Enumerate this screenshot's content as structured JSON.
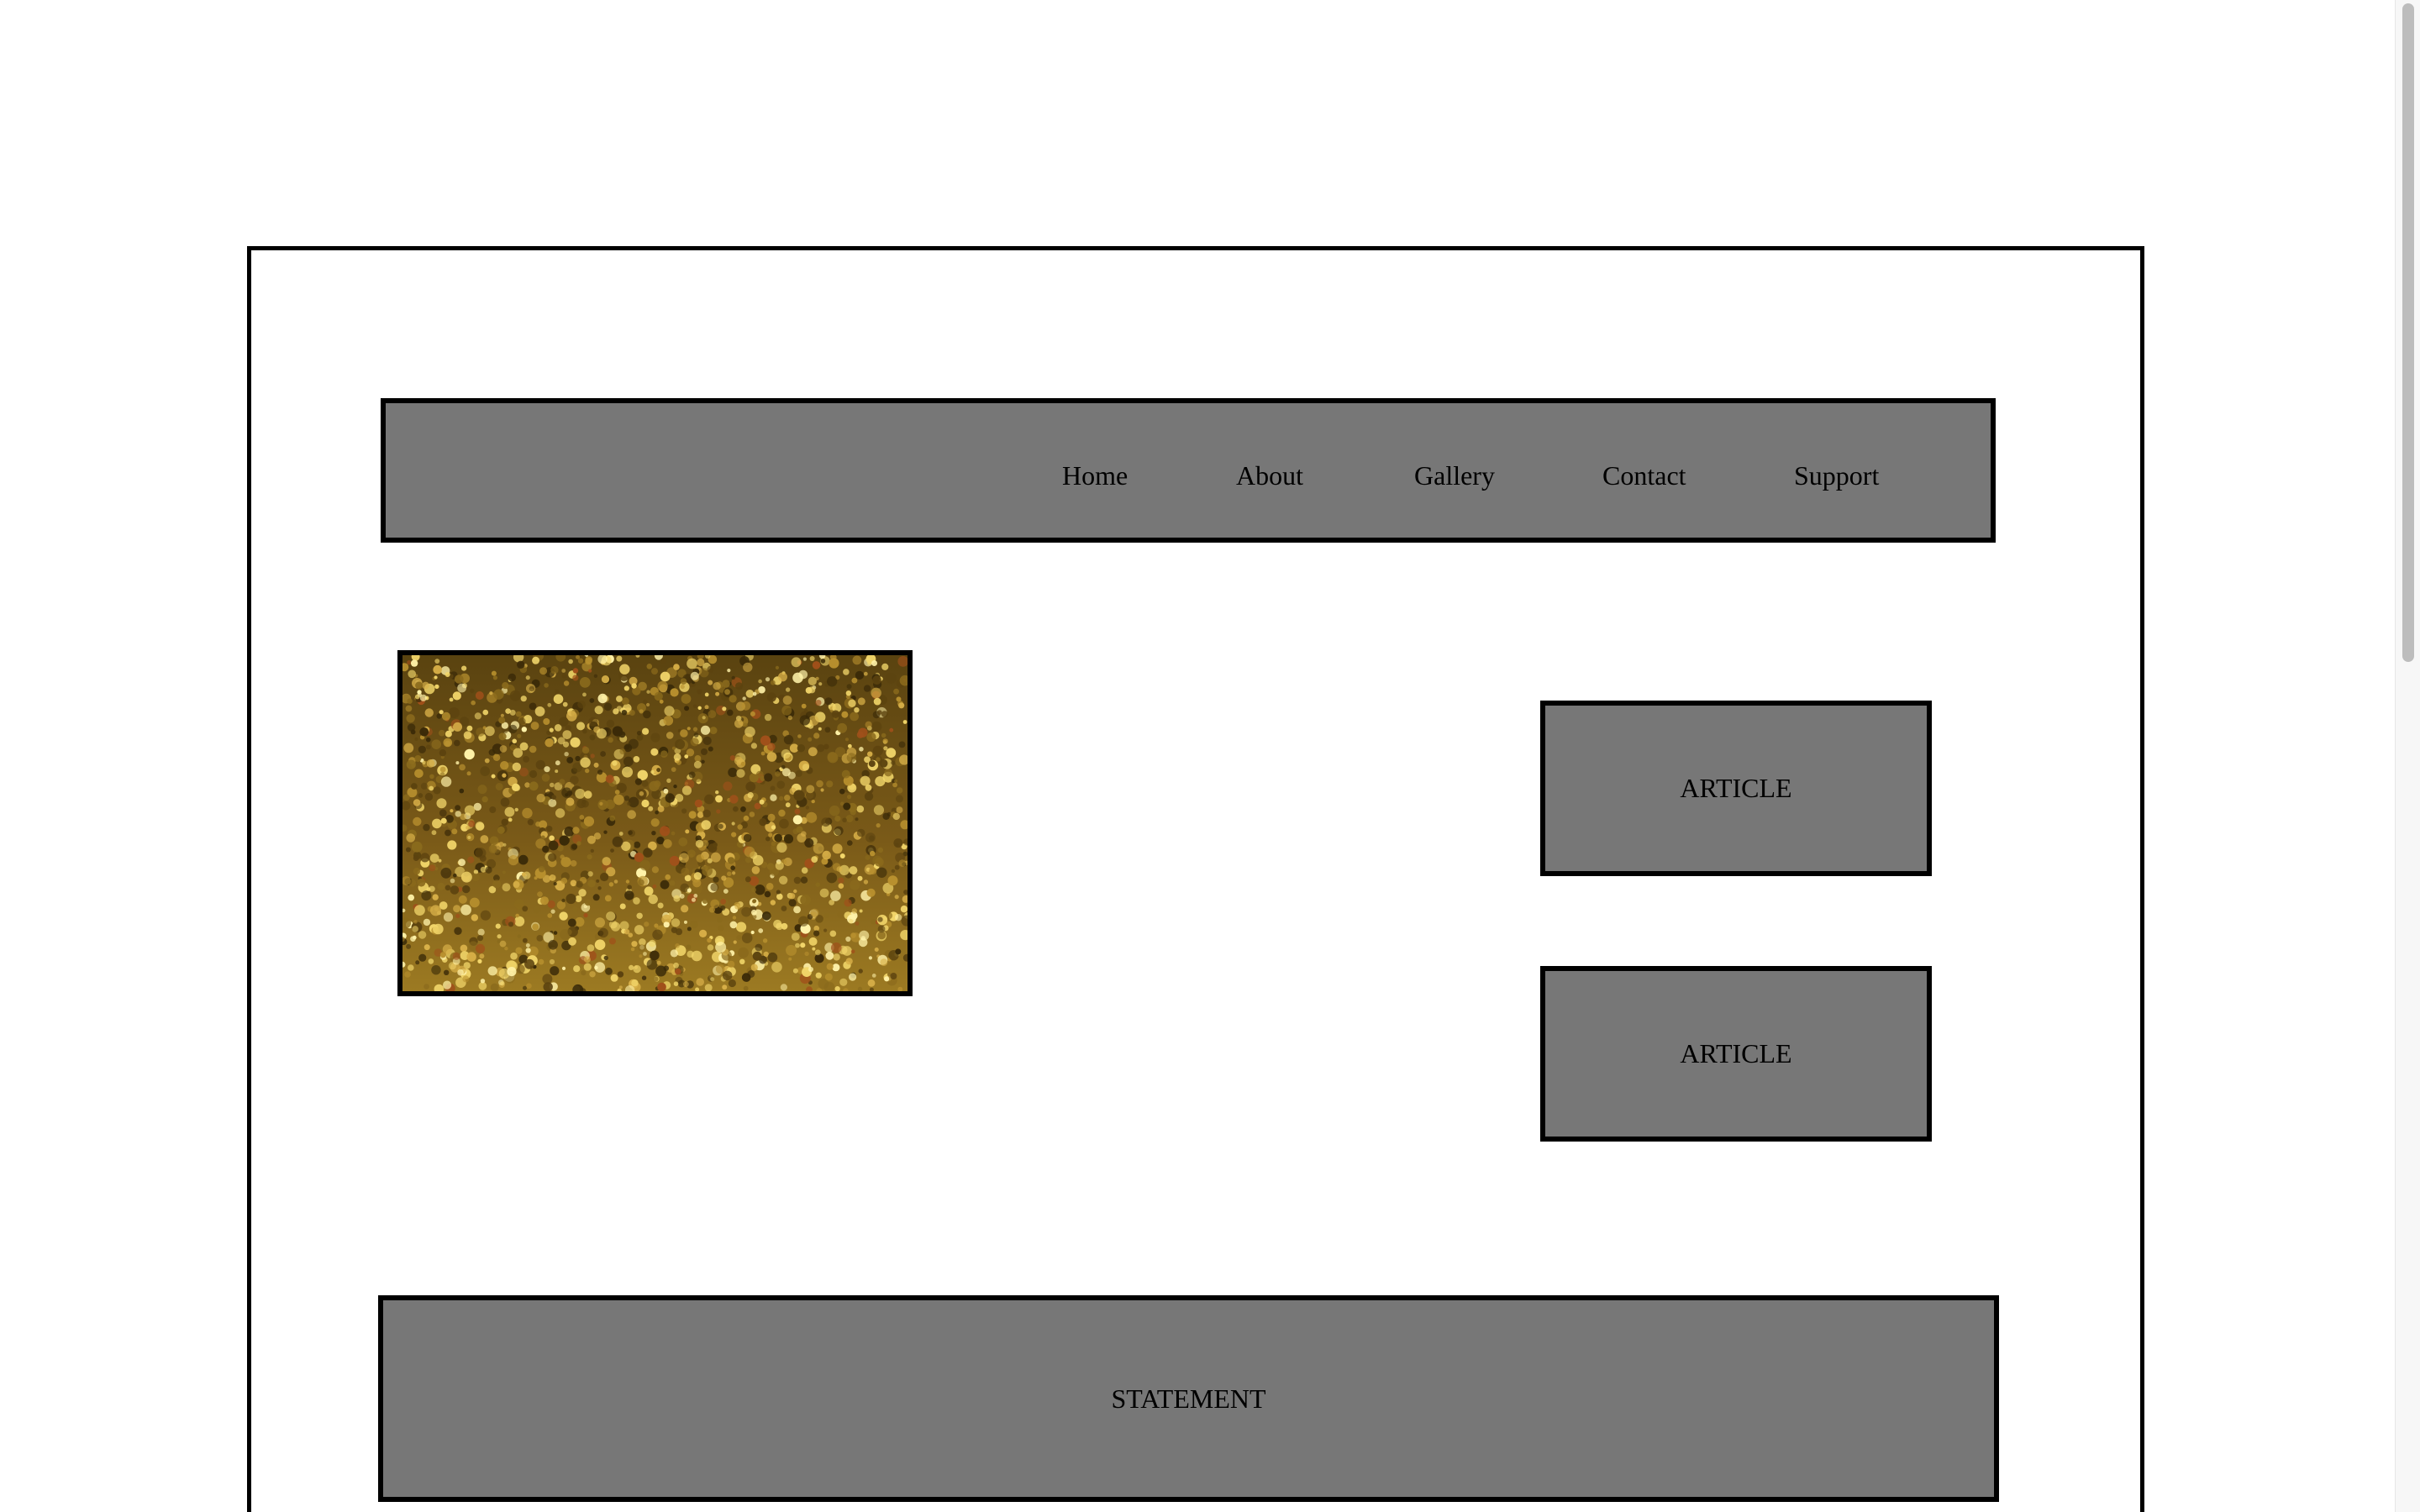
{
  "nav": {
    "items": [
      {
        "label": "Home"
      },
      {
        "label": "About"
      },
      {
        "label": "Gallery"
      },
      {
        "label": "Contact"
      },
      {
        "label": "Support"
      }
    ]
  },
  "hero": {
    "image_description_icon": "gold-glitter-image"
  },
  "articles": [
    {
      "label": "ARTICLE"
    },
    {
      "label": "ARTICLE"
    }
  ],
  "statement": {
    "label": "STATEMENT"
  },
  "colors": {
    "panel_gray": "#777777",
    "border": "#000000",
    "background": "#ffffff"
  }
}
